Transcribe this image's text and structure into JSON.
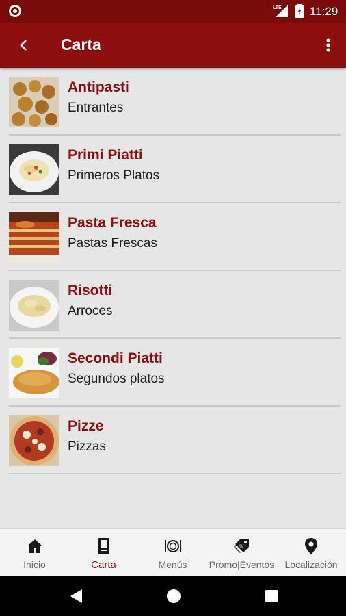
{
  "status_bar": {
    "time": "11:29",
    "network": "LTE"
  },
  "app_bar": {
    "title": "Carta",
    "back_icon": "back-chevron-icon",
    "menu_icon": "more-vert-icon"
  },
  "items": [
    {
      "name": "Antipasti",
      "subtitle": "Entrantes",
      "image": "fried-croquettes-photo"
    },
    {
      "name": "Primi Piatti",
      "subtitle": "Primeros Platos",
      "image": "pasta-plate-photo"
    },
    {
      "name": "Pasta Fresca",
      "subtitle": "Pastas Frescas",
      "image": "lasagna-photo"
    },
    {
      "name": "Risotti",
      "subtitle": "Arroces",
      "image": "risotto-plate-photo"
    },
    {
      "name": "Secondi Piatti",
      "subtitle": "Segundos platos",
      "image": "breaded-cutlet-photo"
    },
    {
      "name": "Pizze",
      "subtitle": "Pizzas",
      "image": "pizza-photo"
    }
  ],
  "bottom_nav": [
    {
      "label": "Inicio",
      "icon": "home-icon",
      "active": false
    },
    {
      "label": "Carta",
      "icon": "menu-card-icon",
      "active": true
    },
    {
      "label": "Menús",
      "icon": "plate-cutlery-icon",
      "active": false
    },
    {
      "label": "Promo|Eventos",
      "icon": "promo-tag-icon",
      "active": false
    },
    {
      "label": "Localización",
      "icon": "location-pin-icon",
      "active": false
    }
  ],
  "colors": {
    "primary": "#8c0e0e",
    "status_bar": "#7a0b0b",
    "background": "#e6e6e6",
    "nav_inactive": "#6a6a6a"
  }
}
